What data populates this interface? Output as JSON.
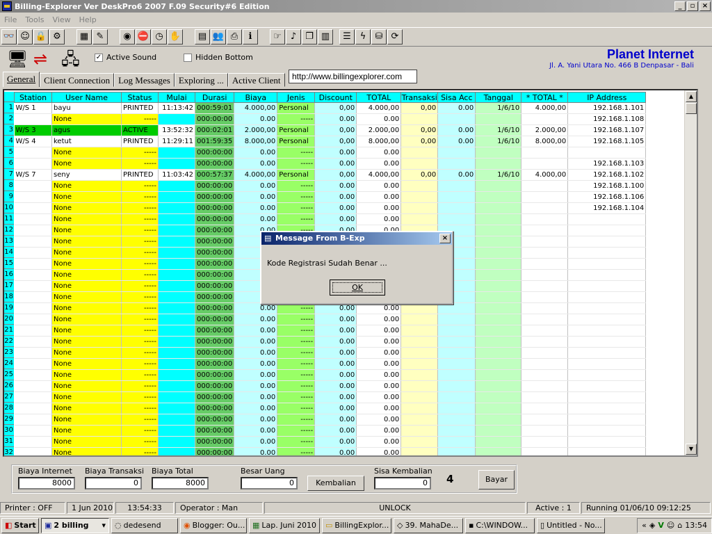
{
  "window": {
    "title": "Billing-Explorer Ver DeskPro6 2007 F.09 Security#6 Edition"
  },
  "menu": [
    "File",
    "Tools",
    "View",
    "Help"
  ],
  "options": {
    "active_sound": "Active Sound",
    "hidden_bottom": "Hidden Bottom"
  },
  "brand": {
    "name": "Planet Internet",
    "address": "Jl. A. Yani Utara No. 466 B  Denpasar - Bali"
  },
  "tabs": [
    "General",
    "Client Connection",
    "Log Messages",
    "Exploring ...",
    "Active Client"
  ],
  "url": "http://www.billingexplorer.com",
  "table": {
    "columns": [
      "Station",
      "User Name",
      "Status",
      "Mulai",
      "Durasi",
      "Biaya",
      "Jenis",
      "Discount",
      "TOTAL",
      "Transaksi",
      "Sisa Acc",
      "Tanggal",
      "* TOTAL *",
      "IP Address"
    ],
    "rows": [
      [
        "W/S 1",
        "bayu",
        "PRINTED",
        "11:13:42",
        "000:59:01",
        "4.000,00",
        "Personal",
        "0,00",
        "4.000,00",
        "0,00",
        "0.00",
        "1/6/10",
        "4.000,00",
        "192.168.1.101"
      ],
      [
        "",
        "None",
        "-----",
        "",
        "000:00:00",
        "0.00",
        "-----",
        "0.00",
        "0.00",
        "",
        "",
        "",
        "",
        "192.168.1.108"
      ],
      [
        "W/S 3",
        "agus",
        "ACTIVE",
        "13:52:32",
        "000:02:01",
        "2.000,00",
        "Personal",
        "0,00",
        "2.000,00",
        "0,00",
        "0.00",
        "1/6/10",
        "2.000,00",
        "192.168.1.107"
      ],
      [
        "W/S 4",
        "ketut",
        "PRINTED",
        "11:29:11",
        "001:59:35",
        "8.000,00",
        "Personal",
        "0,00",
        "8.000,00",
        "0,00",
        "0.00",
        "1/6/10",
        "8.000,00",
        "192.168.1.105"
      ],
      [
        "",
        "None",
        "-----",
        "",
        "000:00:00",
        "0.00",
        "-----",
        "0.00",
        "0.00",
        "",
        "",
        "",
        "",
        ""
      ],
      [
        "",
        "None",
        "-----",
        "",
        "000:00:00",
        "0.00",
        "-----",
        "0.00",
        "0.00",
        "",
        "",
        "",
        "",
        "192.168.1.103"
      ],
      [
        "W/S 7",
        "seny",
        "PRINTED",
        "11:03:42",
        "000:57:37",
        "4.000,00",
        "Personal",
        "0,00",
        "4.000,00",
        "0,00",
        "0.00",
        "1/6/10",
        "4.000,00",
        "192.168.1.102"
      ],
      [
        "",
        "None",
        "-----",
        "",
        "000:00:00",
        "0.00",
        "-----",
        "0.00",
        "0.00",
        "",
        "",
        "",
        "",
        "192.168.1.100"
      ],
      [
        "",
        "None",
        "-----",
        "",
        "000:00:00",
        "0.00",
        "-----",
        "0.00",
        "0.00",
        "",
        "",
        "",
        "",
        "192.168.1.106"
      ],
      [
        "",
        "None",
        "-----",
        "",
        "000:00:00",
        "0.00",
        "-----",
        "0.00",
        "0.00",
        "",
        "",
        "",
        "",
        "192.168.1.104"
      ],
      [
        "",
        "None",
        "-----",
        "",
        "000:00:00",
        "0.00",
        "-----",
        "0.00",
        "0.00",
        "",
        "",
        "",
        "",
        ""
      ],
      [
        "",
        "None",
        "-----",
        "",
        "000:00:00",
        "0.00",
        "-----",
        "0.00",
        "0.00",
        "",
        "",
        "",
        "",
        ""
      ],
      [
        "",
        "None",
        "-----",
        "",
        "000:00:00",
        "0.00",
        "-----",
        "0.00",
        "0.00",
        "",
        "",
        "",
        "",
        ""
      ],
      [
        "",
        "None",
        "-----",
        "",
        "000:00:00",
        "0.00",
        "-----",
        "0.00",
        "0.00",
        "",
        "",
        "",
        "",
        ""
      ],
      [
        "",
        "None",
        "-----",
        "",
        "000:00:00",
        "0.00",
        "-----",
        "0.00",
        "0.00",
        "",
        "",
        "",
        "",
        ""
      ],
      [
        "",
        "None",
        "-----",
        "",
        "000:00:00",
        "0.00",
        "-----",
        "0.00",
        "0.00",
        "",
        "",
        "",
        "",
        ""
      ],
      [
        "",
        "None",
        "-----",
        "",
        "000:00:00",
        "0.00",
        "-----",
        "0.00",
        "0.00",
        "",
        "",
        "",
        "",
        ""
      ],
      [
        "",
        "None",
        "-----",
        "",
        "000:00:00",
        "0.00",
        "-----",
        "0.00",
        "0.00",
        "",
        "",
        "",
        "",
        ""
      ],
      [
        "",
        "None",
        "-----",
        "",
        "000:00:00",
        "0.00",
        "-----",
        "0.00",
        "0.00",
        "",
        "",
        "",
        "",
        ""
      ],
      [
        "",
        "None",
        "-----",
        "",
        "000:00:00",
        "0.00",
        "-----",
        "0.00",
        "0.00",
        "",
        "",
        "",
        "",
        ""
      ],
      [
        "",
        "None",
        "-----",
        "",
        "000:00:00",
        "0.00",
        "-----",
        "0.00",
        "0.00",
        "",
        "",
        "",
        "",
        ""
      ],
      [
        "",
        "None",
        "-----",
        "",
        "000:00:00",
        "0.00",
        "-----",
        "0.00",
        "0.00",
        "",
        "",
        "",
        "",
        ""
      ],
      [
        "",
        "None",
        "-----",
        "",
        "000:00:00",
        "0.00",
        "-----",
        "0.00",
        "0.00",
        "",
        "",
        "",
        "",
        ""
      ],
      [
        "",
        "None",
        "-----",
        "",
        "000:00:00",
        "0.00",
        "-----",
        "0.00",
        "0.00",
        "",
        "",
        "",
        "",
        ""
      ],
      [
        "",
        "None",
        "-----",
        "",
        "000:00:00",
        "0.00",
        "-----",
        "0.00",
        "0.00",
        "",
        "",
        "",
        "",
        ""
      ],
      [
        "",
        "None",
        "-----",
        "",
        "000:00:00",
        "0.00",
        "-----",
        "0.00",
        "0.00",
        "",
        "",
        "",
        "",
        ""
      ],
      [
        "",
        "None",
        "-----",
        "",
        "000:00:00",
        "0.00",
        "-----",
        "0.00",
        "0.00",
        "",
        "",
        "",
        "",
        ""
      ],
      [
        "",
        "None",
        "-----",
        "",
        "000:00:00",
        "0.00",
        "-----",
        "0.00",
        "0.00",
        "",
        "",
        "",
        "",
        ""
      ],
      [
        "",
        "None",
        "-----",
        "",
        "000:00:00",
        "0.00",
        "-----",
        "0.00",
        "0.00",
        "",
        "",
        "",
        "",
        ""
      ],
      [
        "",
        "None",
        "-----",
        "",
        "000:00:00",
        "0.00",
        "-----",
        "0.00",
        "0.00",
        "",
        "",
        "",
        "",
        ""
      ],
      [
        "",
        "None",
        "-----",
        "",
        "000:00:00",
        "0.00",
        "-----",
        "0.00",
        "0.00",
        "",
        "",
        "",
        "",
        ""
      ],
      [
        "",
        "None",
        "-----",
        "",
        "000:00:00",
        "0.00",
        "-----",
        "0.00",
        "0.00",
        "",
        "",
        "",
        "",
        ""
      ]
    ],
    "colors": {
      "header": "#00ffff",
      "username": "#ffff00",
      "status": "#ffff00",
      "mulai": "#00ffff",
      "durasi": "#66cc66",
      "biaya": "#c0ffff",
      "jenis": "#99ff66",
      "discount": "#c0ffff",
      "total": "#ffffff",
      "transaksi": "#ffffc0",
      "sisa": "#c0ffff",
      "tanggal": "#c0ffc0",
      "active_row": "#00cc00"
    }
  },
  "bottom": {
    "biaya_internet_label": "Biaya Internet",
    "biaya_internet": "8000",
    "biaya_transaksi_label": "Biaya Transaksi",
    "biaya_transaksi": "0",
    "biaya_total_label": "Biaya Total",
    "biaya_total": "8000",
    "besar_uang_label": "Besar Uang",
    "besar_uang": "0",
    "kembalian_button": "Kembalian",
    "sisa_kembalian_label": "Sisa Kembalian",
    "sisa_kembalian": "0",
    "count": "4",
    "bayar_button": "Bayar"
  },
  "status": {
    "printer": "Printer : OFF",
    "date": "1 Jun 2010",
    "time": "13:54:33",
    "operator": "Operator : Man",
    "lock": "UNLOCK",
    "active": "Active : 1",
    "running": "Running 01/06/10  09:12:25"
  },
  "taskbar": {
    "start": "Start",
    "tasks": [
      "2 billing",
      "dedesend",
      "Blogger: Ou...",
      "Lap. Juni 2010",
      "BillingExplor...",
      "39. MahaDe...",
      "C:\\WINDOW...",
      "Untitled - No..."
    ],
    "clock": "13:54"
  },
  "dialog": {
    "title": "Message From B-Exp",
    "message": "Kode Registrasi Sudah Benar ...",
    "ok": "OK"
  }
}
